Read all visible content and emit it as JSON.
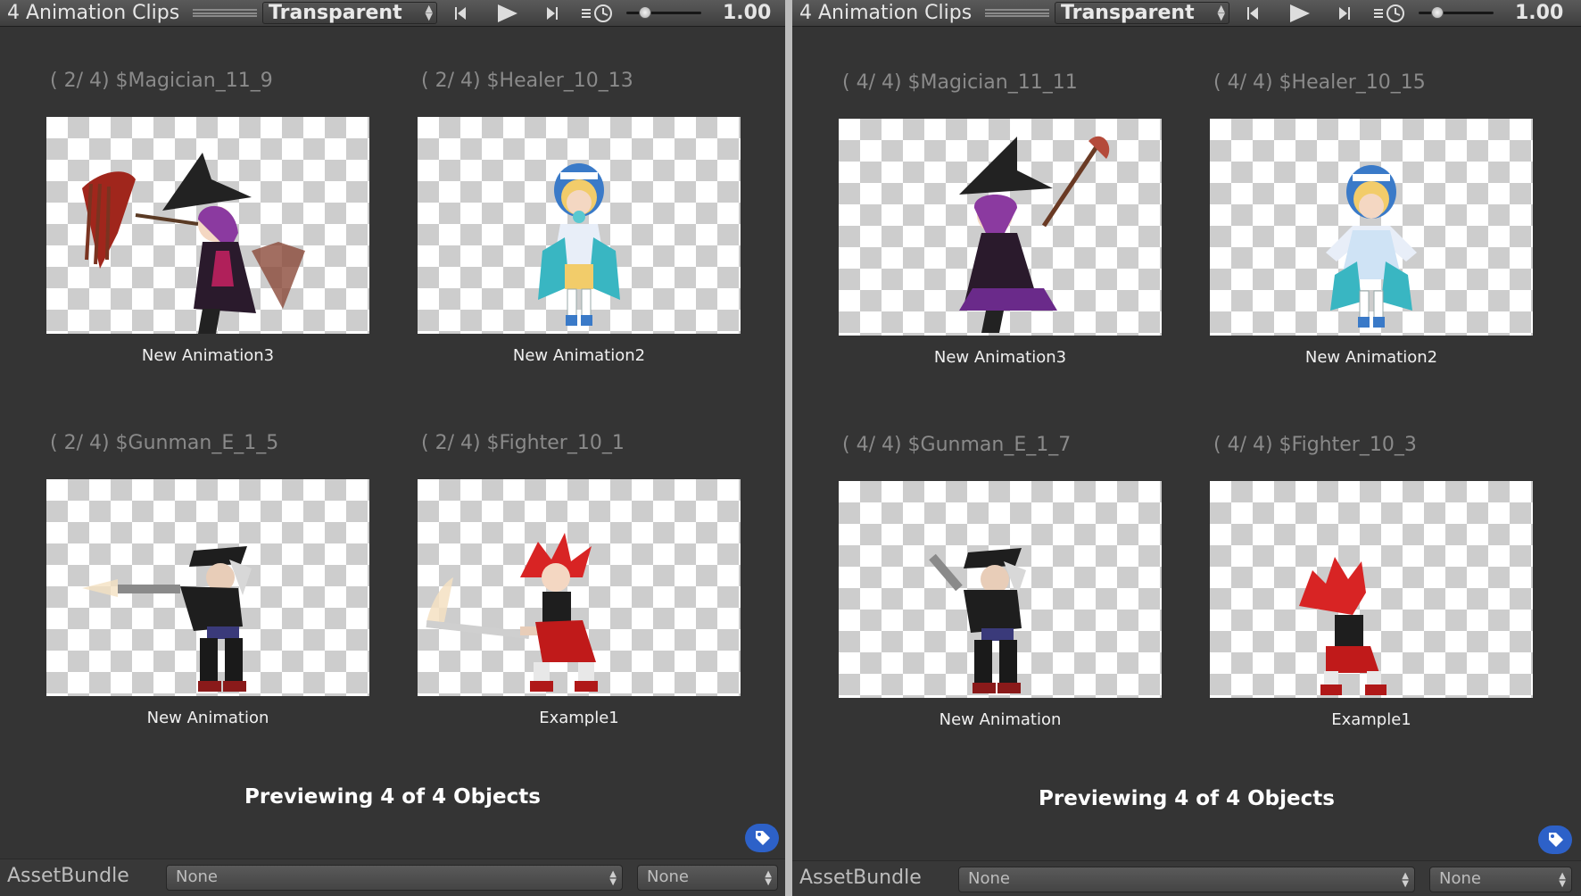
{
  "panels": [
    {
      "title": "4 Animation Clips",
      "background_option": "Transparent",
      "speed": "1.00",
      "clips": [
        {
          "header": "( 2/ 4) $Magician_11_9",
          "name": "New Animation3"
        },
        {
          "header": "( 2/ 4) $Healer_10_13",
          "name": "New Animation2"
        },
        {
          "header": "( 2/ 4) $Gunman_E_1_5",
          "name": "New Animation"
        },
        {
          "header": "( 2/ 4) $Fighter_10_1",
          "name": "Example1"
        }
      ],
      "footer": "Previewing 4 of 4 Objects",
      "assetbundle": {
        "label": "AssetBundle",
        "name_value": "None",
        "variant_value": "None"
      }
    },
    {
      "title": "4 Animation Clips",
      "background_option": "Transparent",
      "speed": "1.00",
      "clips": [
        {
          "header": "( 4/ 4) $Magician_11_11",
          "name": "New Animation3"
        },
        {
          "header": "( 4/ 4) $Healer_10_15",
          "name": "New Animation2"
        },
        {
          "header": "( 4/ 4) $Gunman_E_1_7",
          "name": "New Animation"
        },
        {
          "header": "( 4/ 4) $Fighter_10_3",
          "name": "Example1"
        }
      ],
      "footer": "Previewing 4 of 4 Objects",
      "assetbundle": {
        "label": "AssetBundle",
        "name_value": "None",
        "variant_value": "None"
      }
    }
  ],
  "speed_slider_value": 1.0,
  "icons": {
    "step_back": "step-back-icon",
    "play": "play-icon",
    "step_forward": "step-forward-icon",
    "speed": "playback-speed-icon",
    "tag": "tag-icon"
  },
  "colors": {
    "panel_bg": "#343434",
    "header_text": "#8a8a8a",
    "tag_button": "#2d61c8",
    "checker_light": "#ffffff",
    "checker_dark": "#cdcdcd"
  }
}
